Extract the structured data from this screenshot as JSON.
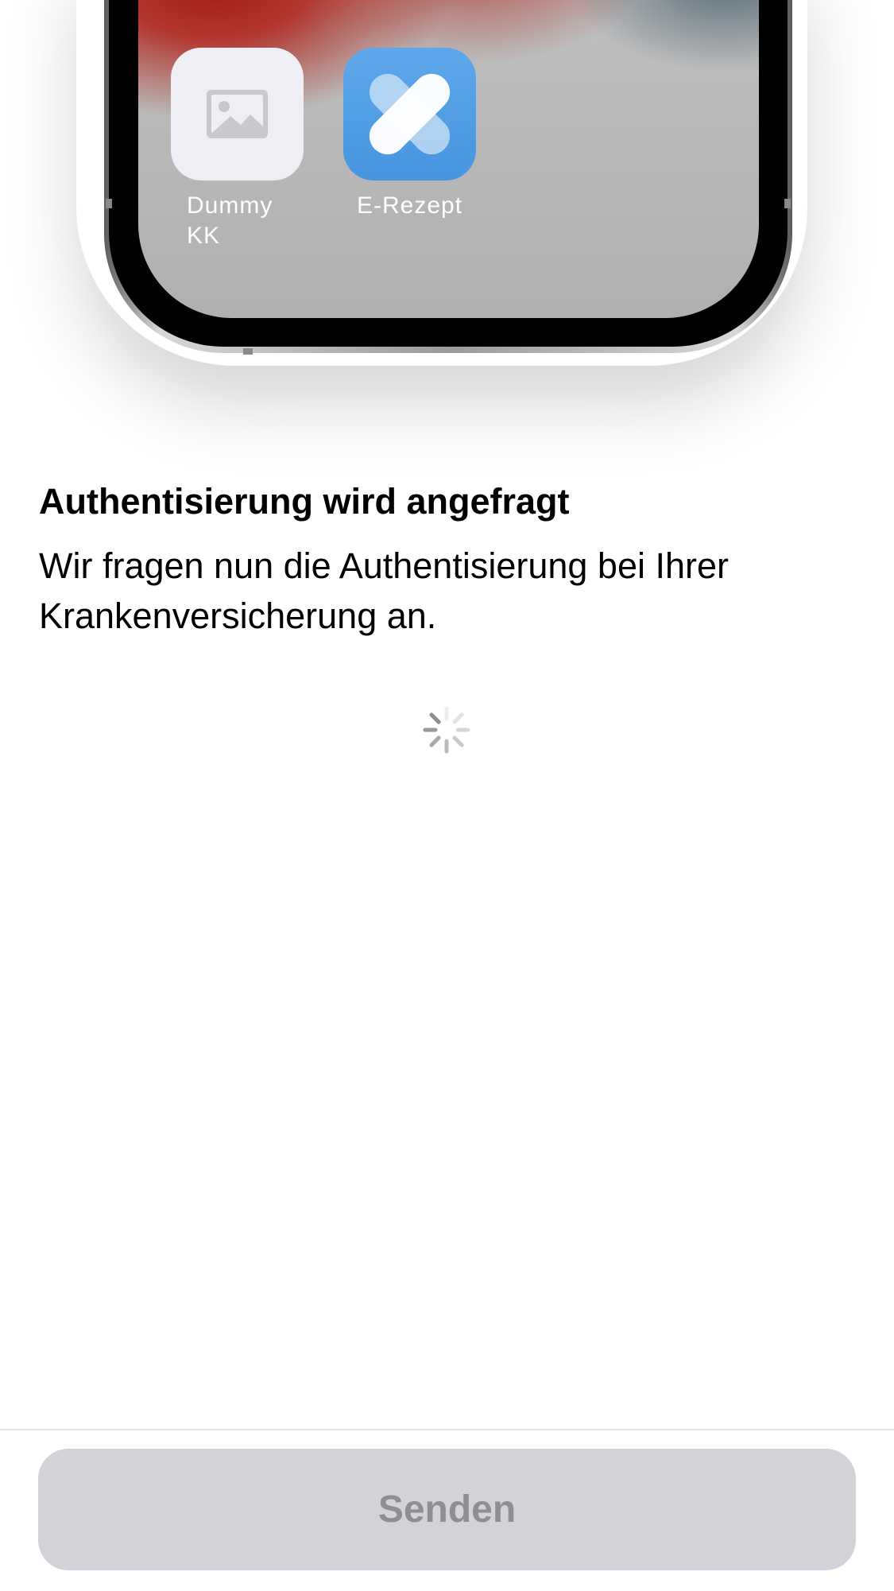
{
  "illustration": {
    "apps": [
      {
        "label": "Dummy\nKK",
        "icon": "image-placeholder-icon"
      },
      {
        "label": "E-Rezept",
        "icon": "erezept-logo-icon"
      }
    ]
  },
  "content": {
    "title": "Authentisierung wird angefragt",
    "description": "Wir fragen nun die Authentisierung bei Ihrer Krankenversicherung an.",
    "loading_indicator": "spinner-icon"
  },
  "footer": {
    "send_label": "Senden",
    "send_enabled": false
  },
  "colors": {
    "button_bg_disabled": "#d2d2d8",
    "button_text_disabled": "#8e8e94",
    "erezept_blue": "#4b9be3"
  }
}
